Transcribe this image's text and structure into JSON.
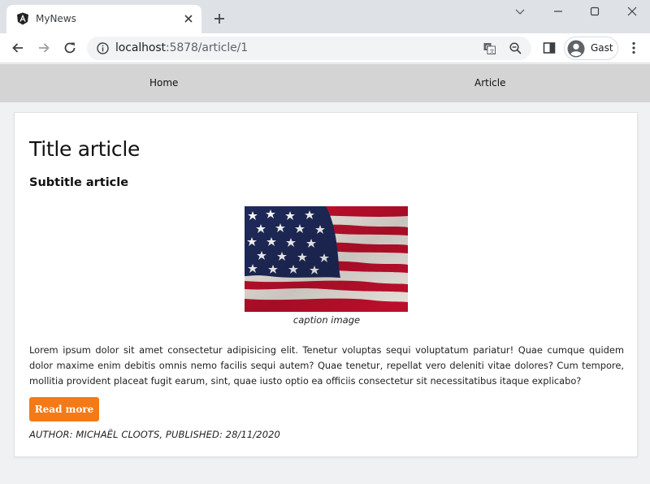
{
  "browser": {
    "tab_title": "MyNews",
    "url_host": "localhost",
    "url_rest": ":5878/article/1",
    "profile_name": "Gast"
  },
  "nav": {
    "items": [
      {
        "label": "Home"
      },
      {
        "label": "Article"
      }
    ]
  },
  "article": {
    "title": "Title article",
    "subtitle": "Subtitle article",
    "caption": "caption image",
    "body": "Lorem ipsum dolor sit amet consectetur adipisicing elit. Tenetur voluptas sequi voluptatum pariatur! Quae cumque quidem dolor maxime enim debitis omnis nemo facilis sequi autem? Quae tenetur, repellat vero deleniti vitae dolores? Cum tempore, mollitia provident placeat fugit earum, sint, quae iusto optio ea officiis consectetur sit necessitatibus itaque explicabo?",
    "read_more_label": "Read more",
    "meta": "AUTHOR: MICHAËL CLOOTS, PUBLISHED: 28/11/2020"
  },
  "colors": {
    "accent": "#f47a17",
    "navbar": "#d4d4d4"
  }
}
